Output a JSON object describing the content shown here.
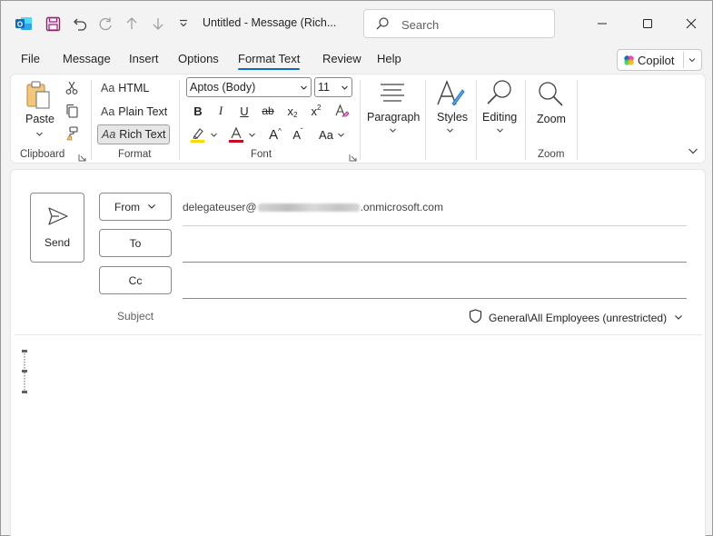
{
  "window": {
    "title": "Untitled  -  Message (Rich...",
    "search_placeholder": "Search"
  },
  "tabs": [
    {
      "label": "File"
    },
    {
      "label": "Message"
    },
    {
      "label": "Insert"
    },
    {
      "label": "Options"
    },
    {
      "label": "Format Text",
      "active": true
    },
    {
      "label": "Review"
    },
    {
      "label": "Help"
    }
  ],
  "copilot": {
    "label": "Copilot"
  },
  "ribbon": {
    "clipboard": {
      "paste_label": "Paste",
      "group_label": "Clipboard"
    },
    "format": {
      "html_label": "HTML",
      "plain_label": "Plain Text",
      "rich_label": "Rich Text",
      "selected": "Rich Text",
      "aa_glyph": "Aa",
      "group_label": "Format"
    },
    "font": {
      "font_name": "Aptos (Body)",
      "font_size": "11",
      "bold": "B",
      "italic": "I",
      "underline": "U",
      "strike": "ab",
      "subscript": "x",
      "superscript": "x",
      "grow": "A",
      "shrink": "A",
      "case": "Aa",
      "group_label": "Font",
      "highlight_color": "#ffd800",
      "font_color": "#c50f1f"
    },
    "paragraph": {
      "label": "Paragraph"
    },
    "styles": {
      "label": "Styles"
    },
    "editing": {
      "label": "Editing"
    },
    "zoom": {
      "label": "Zoom",
      "group_label": "Zoom"
    }
  },
  "message": {
    "send_label": "Send",
    "from_label": "From",
    "from_prefix": "delegateuser@",
    "from_suffix": ".onmicrosoft.com",
    "to_label": "To",
    "cc_label": "Cc",
    "subject_label": "Subject",
    "sensitivity": "General\\All Employees (unrestricted)"
  },
  "colors": {
    "accent": "#0f6cbd",
    "outlook_blue": "#0f6cbd",
    "save_purple": "#a3177a"
  }
}
